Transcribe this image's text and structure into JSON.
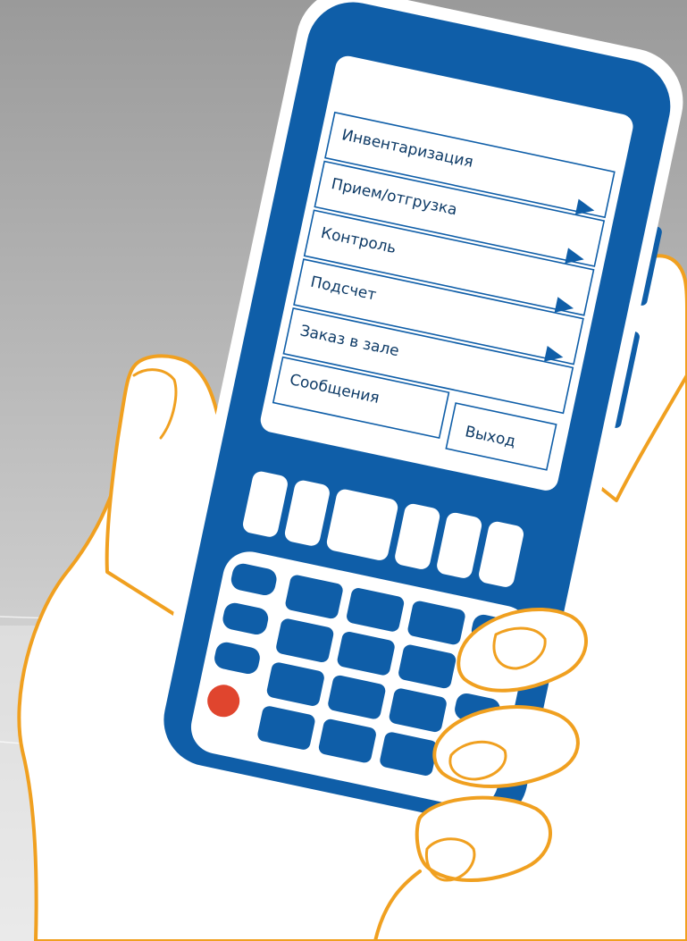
{
  "colors": {
    "background_top": "#9d9d9d",
    "background_bottom": "#eeeeee",
    "device_body": "#0f5ea8",
    "device_outline": "#ffffff",
    "screen": "#ffffff",
    "menu_text": "#0d3a66",
    "arrow": "#0f5ea8",
    "hand_outline": "#f0a020",
    "hand_fill": "#ffffff",
    "power_button": "#e0452e"
  },
  "screen_menu": {
    "items": [
      {
        "label": "Инвентаризация",
        "has_arrow": true
      },
      {
        "label": "Прием/отгрузка",
        "has_arrow": true
      },
      {
        "label": "Контроль",
        "has_arrow": true
      },
      {
        "label": "Подсчет",
        "has_arrow": true
      },
      {
        "label": "Заказ в зале",
        "has_arrow": false
      }
    ],
    "messages_label": "Сообщения",
    "exit_label": "Выход"
  },
  "icons": {
    "menu_arrow": "right-triangle-icon",
    "power": "red-circle-button-icon"
  }
}
